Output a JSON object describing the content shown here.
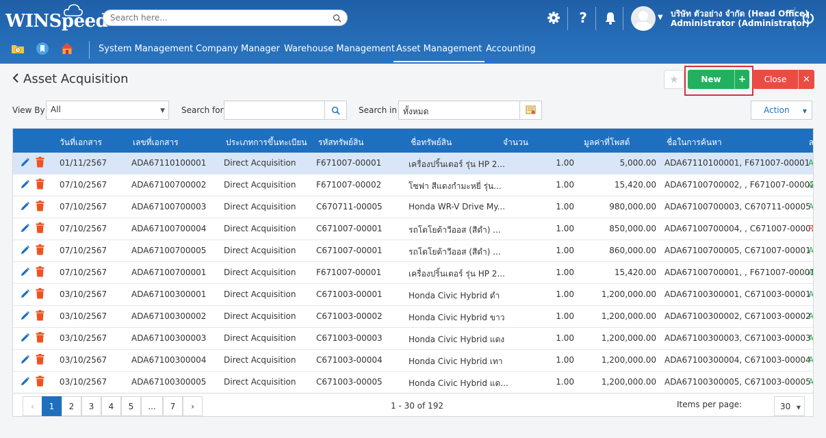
{
  "header": {
    "logo_text": "WINSpeed",
    "search_placeholder": "Search here...",
    "user_org": "บริษัท ตัวอย่าง จำกัด (Head Office)",
    "user_name": "Administrator (Administrator)",
    "help_glyph": "?"
  },
  "nav": {
    "items": [
      {
        "label": "System Management"
      },
      {
        "label": "Company Manager"
      },
      {
        "label": "Warehouse Management"
      },
      {
        "label": "Asset Management",
        "active": true
      },
      {
        "label": "Accounting"
      }
    ]
  },
  "page": {
    "title": "Asset Acquisition",
    "new_label": "New",
    "new_plus": "+",
    "close_label": "Close",
    "close_x": "✕"
  },
  "filters": {
    "view_by_label": "View By",
    "view_by_value": "All",
    "search_for_label": "Search for",
    "search_for_value": "",
    "search_in_label": "Search in",
    "search_in_value": "ทั้งหมด",
    "action_label": "Action"
  },
  "table": {
    "columns": [
      "วันที่เอกสาร",
      "เลขที่เอกสาร",
      "ประเภทการขึ้นทะเบียน",
      "รหัสทรัพย์สิน",
      "ชื่อทรัพย์สิน",
      "จำนวน",
      "มูลค่าที่โพสต์",
      "ชื่อในการค้นหา",
      "ส"
    ],
    "rows": [
      {
        "date": "01/11/2567",
        "doc_no": "ADA67110100001",
        "type": "Direct Acquisition",
        "asset_code": "F671007-00001",
        "asset_name": "เครื่องปริ้นเตอร์ รุ่น HP 2...",
        "qty": "1.00",
        "value": "5,000.00",
        "search_name": "ADA67110100001, F671007-00001",
        "status": "A",
        "selected": true
      },
      {
        "date": "07/10/2567",
        "doc_no": "ADA67100700002",
        "type": "Direct Acquisition",
        "asset_code": "F671007-00002",
        "asset_name": "โซฟา สีแดงกำมะหยี่ รุ่น...",
        "qty": "1.00",
        "value": "15,420.00",
        "search_name": "ADA67100700002, , F671007-00002",
        "status": "A"
      },
      {
        "date": "07/10/2567",
        "doc_no": "ADA67100700003",
        "type": "Direct Acquisition",
        "asset_code": "C670711-00005",
        "asset_name": "Honda WR-V Drive My...",
        "qty": "1.00",
        "value": "980,000.00",
        "search_name": "ADA67100700003, C670711-00005",
        "status": "A"
      },
      {
        "date": "07/10/2567",
        "doc_no": "ADA67100700004",
        "type": "Direct Acquisition",
        "asset_code": "C671007-00001",
        "asset_name": "รถโตโยต้าวีออส (สีดำ) ...",
        "qty": "1.00",
        "value": "850,000.00",
        "search_name": "ADA67100700004, , C671007-00001",
        "status": "R",
        "status_red": true
      },
      {
        "date": "07/10/2567",
        "doc_no": "ADA67100700005",
        "type": "Direct Acquisition",
        "asset_code": "C671007-00001",
        "asset_name": "รถโตโยต้าวีออส (สีดำ) ...",
        "qty": "1.00",
        "value": "860,000.00",
        "search_name": "ADA67100700005, C671007-00001",
        "status": "A"
      },
      {
        "date": "07/10/2567",
        "doc_no": "ADA67100700001",
        "type": "Direct Acquisition",
        "asset_code": "F671007-00001",
        "asset_name": "เครื่องปริ้นเตอร์ รุ่น HP 2...",
        "qty": "1.00",
        "value": "15,420.00",
        "search_name": "ADA67100700001, , F671007-00001",
        "status": "A"
      },
      {
        "date": "03/10/2567",
        "doc_no": "ADA67100300001",
        "type": "Direct Acquisition",
        "asset_code": "C671003-00001",
        "asset_name": "Honda Civic Hybrid ดำ",
        "qty": "1.00",
        "value": "1,200,000.00",
        "search_name": "ADA67100300001, C671003-00001",
        "status": "A"
      },
      {
        "date": "03/10/2567",
        "doc_no": "ADA67100300002",
        "type": "Direct Acquisition",
        "asset_code": "C671003-00002",
        "asset_name": "Honda Civic Hybrid ขาว",
        "qty": "1.00",
        "value": "1,200,000.00",
        "search_name": "ADA67100300002, C671003-00002",
        "status": "A"
      },
      {
        "date": "03/10/2567",
        "doc_no": "ADA67100300003",
        "type": "Direct Acquisition",
        "asset_code": "C671003-00003",
        "asset_name": "Honda Civic Hybrid แดง",
        "qty": "1.00",
        "value": "1,200,000.00",
        "search_name": "ADA67100300003, C671003-00003",
        "status": "A"
      },
      {
        "date": "03/10/2567",
        "doc_no": "ADA67100300004",
        "type": "Direct Acquisition",
        "asset_code": "C671003-00004",
        "asset_name": "Honda Civic Hybrid เทา",
        "qty": "1.00",
        "value": "1,200,000.00",
        "search_name": "ADA67100300004, C671003-00004",
        "status": "A"
      },
      {
        "date": "03/10/2567",
        "doc_no": "ADA67100300005",
        "type": "Direct Acquisition",
        "asset_code": "C671003-00005",
        "asset_name": "Honda Civic Hybrid แด...",
        "qty": "1.00",
        "value": "1,200,000.00",
        "search_name": "ADA67100300005, C671003-00005",
        "status": "A"
      }
    ]
  },
  "pagination": {
    "prev": "‹",
    "next": "›",
    "pages": [
      "1",
      "2",
      "3",
      "4",
      "5",
      "...",
      "7"
    ],
    "current": "1",
    "info": "1 - 30 of 192",
    "items_per_page_label": "Items per page:",
    "items_per_page": "30"
  },
  "colors": {
    "header_blue": "#1f5fa8",
    "grid_header": "#1f6fbf",
    "new_green": "#22b05e",
    "close_red": "#ea4c43",
    "status_green": "#22a04b",
    "status_red": "#e04b3a",
    "edit_blue": "#1f6fbf",
    "delete_orange": "#f0521f"
  },
  "icons": {
    "search": "search-icon",
    "settings": "gear-icon",
    "help": "help-icon",
    "notifications": "bell-icon",
    "power": "power-icon",
    "edit": "pencil-icon",
    "delete": "trash-icon"
  }
}
